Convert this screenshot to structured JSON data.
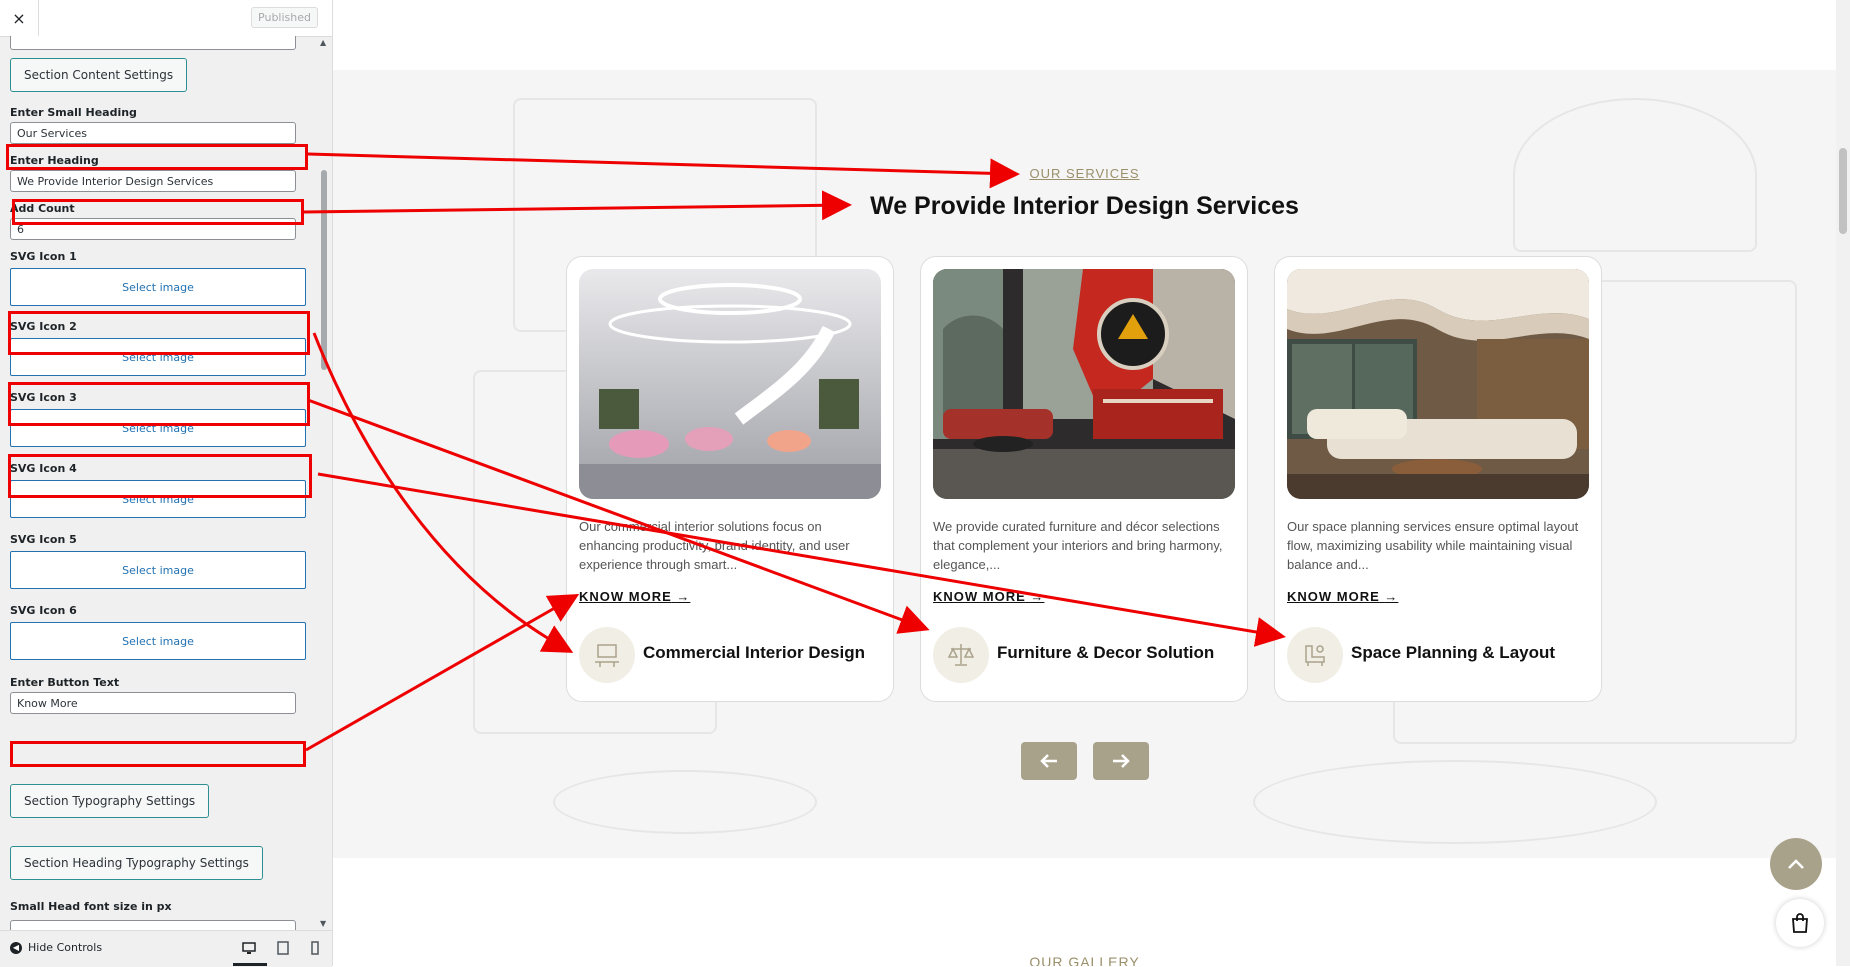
{
  "panel": {
    "close_glyph": "×",
    "published_label": "Published",
    "section_content_btn": "Section Content Settings",
    "small_heading_label": "Enter Small Heading",
    "small_heading_value": "Our Services",
    "heading_label": "Enter Heading",
    "heading_value": "We Provide Interior Design Services",
    "add_count_label": "Add Count",
    "add_count_value": "6",
    "svg_icons": [
      {
        "label": "SVG Icon 1",
        "button": "Select image"
      },
      {
        "label": "SVG Icon 2",
        "button": "Select image"
      },
      {
        "label": "SVG Icon 3",
        "button": "Select image"
      },
      {
        "label": "SVG Icon 4",
        "button": "Select image"
      },
      {
        "label": "SVG Icon 5",
        "button": "Select image"
      },
      {
        "label": "SVG Icon 6",
        "button": "Select image"
      }
    ],
    "button_text_label": "Enter Button Text",
    "button_text_value": "Know More",
    "typography_btn": "Section Typography Settings",
    "heading_typography_btn": "Section Heading Typography Settings",
    "small_head_font_label": "Small Head font size in px",
    "hide_controls": "Hide Controls",
    "devices": [
      "desktop-icon",
      "tablet-icon",
      "mobile-icon"
    ]
  },
  "preview": {
    "small_heading": "OUR SERVICES",
    "heading": "We Provide Interior Design Services",
    "cards": [
      {
        "desc": "Our commercial interior solutions focus on enhancing productivity, brand identity, and user experience through smart...",
        "more": "KNOW MORE",
        "title": "Commercial Interior Design",
        "icon": "office-desk-icon"
      },
      {
        "desc": "We provide curated furniture and décor selections that complement your interiors and bring harmony, elegance,...",
        "more": "KNOW MORE",
        "title": "Furniture & Decor Solution",
        "icon": "scales-icon"
      },
      {
        "desc": "Our space planning services ensure optimal layout flow, maximizing usability while maintaining visual balance and...",
        "more": "KNOW MORE",
        "title": "Space Planning & Layout",
        "icon": "chair-plan-icon"
      }
    ],
    "gallery_heading": "OUR GALLERY"
  },
  "colors": {
    "accent": "#a9a28b",
    "annotation_red": "#e00000",
    "link_blue": "#2271b1"
  }
}
